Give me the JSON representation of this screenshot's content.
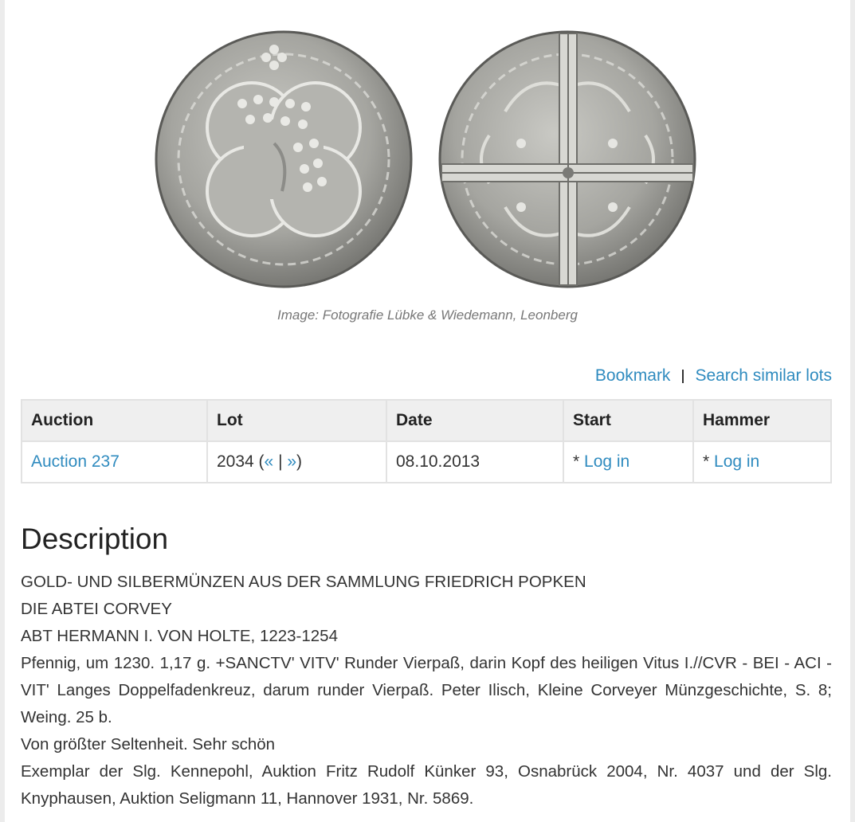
{
  "image": {
    "caption": "Image: Fotografie Lübke & Wiedemann, Leonberg"
  },
  "actions": {
    "bookmark": "Bookmark",
    "search_similar": "Search similar lots"
  },
  "table": {
    "headers": [
      "Auction",
      "Lot",
      "Date",
      "Start",
      "Hammer"
    ],
    "row": {
      "auction": "Auction 237",
      "lot_number": "2034",
      "lot_paren_open": " (",
      "prev": "«",
      "nav_sep": " | ",
      "next": "»",
      "lot_paren_close": ")",
      "date": "08.10.2013",
      "start_prefix": "* ",
      "start_link": "Log in",
      "hammer_prefix": "* ",
      "hammer_link": "Log in"
    }
  },
  "description": {
    "title": "Description",
    "lines": [
      "GOLD- UND SILBERMÜNZEN AUS DER SAMMLUNG FRIEDRICH POPKEN",
      "DIE ABTEI CORVEY",
      "ABT HERMANN I. VON HOLTE, 1223-1254",
      "Pfennig, um 1230. 1,17 g. +SANCTV' VITV' Runder Vierpaß, darin Kopf des heiligen Vitus I.//CVR - BEI - ACI - VIT' Langes Doppelfadenkreuz, darum runder Vierpaß. Peter Ilisch, Kleine Corveyer Münzgeschichte, S. 8; Weing. 25 b.",
      "Von größter Seltenheit. Sehr schön",
      "Exemplar der Slg. Kennepohl, Auktion Fritz Rudolf Künker 93, Osnabrück 2004, Nr. 4037 und der Slg. Knyphausen, Auktion Seligmann 11, Hannover 1931, Nr. 5869."
    ]
  },
  "colors": {
    "link": "#2f8bbf",
    "header_bg": "#efefef",
    "border": "#e2e2e2",
    "coin": "#a9a9a4"
  }
}
